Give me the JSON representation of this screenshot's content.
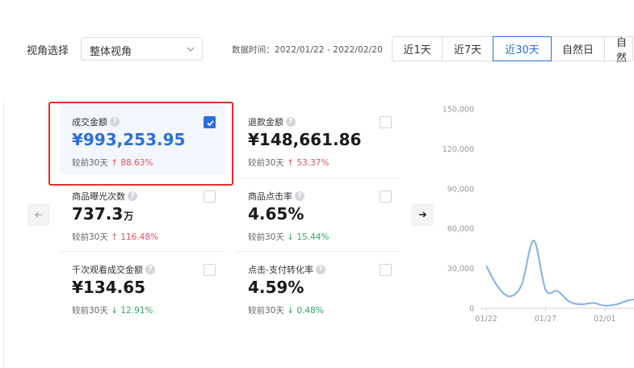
{
  "filter": {
    "label": "视角选择",
    "selected": "整体视角"
  },
  "date_range": "数据时间：2022/01/22 - 2022/02/20",
  "range_tabs": [
    {
      "label": "近1天",
      "active": false
    },
    {
      "label": "近7天",
      "active": false
    },
    {
      "label": "近30天",
      "active": true
    },
    {
      "label": "自然日",
      "active": false
    },
    {
      "label": "自然",
      "active": false
    }
  ],
  "metrics": [
    {
      "title": "成交金额",
      "value": "¥993,253.95",
      "unit": "",
      "compare_label": "较前30天",
      "delta": "88.63%",
      "direction": "up",
      "checked": true
    },
    {
      "title": "退款金额",
      "value": "¥148,661.86",
      "unit": "",
      "compare_label": "较前30天",
      "delta": "53.37%",
      "direction": "up",
      "checked": false
    },
    {
      "title": "商品曝光次数",
      "value": "737.3",
      "unit": "万",
      "compare_label": "较前30天",
      "delta": "116.48%",
      "direction": "up",
      "checked": false
    },
    {
      "title": "商品点击率",
      "value": "4.65%",
      "unit": "",
      "compare_label": "较前30天",
      "delta": "15.44%",
      "direction": "down",
      "checked": false
    },
    {
      "title": "千次观看成交金额",
      "value": "¥134.65",
      "unit": "",
      "compare_label": "较前30天",
      "delta": "12.91%",
      "direction": "down",
      "checked": false
    },
    {
      "title": "点击-支付转化率",
      "value": "4.59%",
      "unit": "",
      "compare_label": "较前30天",
      "delta": "0.48%",
      "direction": "down",
      "checked": false
    }
  ],
  "colors": {
    "accent": "#2a6fe0",
    "up": "#e8505b",
    "down": "#2fab5c",
    "highlight_frame": "#d9332a",
    "line": "#86aee8"
  },
  "chart_data": {
    "type": "line",
    "y_ticks": [
      "150,000",
      "120,000",
      "90,000",
      "60,000",
      "30,000",
      "0"
    ],
    "x_ticks": [
      "01/22",
      "01/27",
      "02/01"
    ],
    "ylim": [
      0,
      150000
    ],
    "x_range": [
      "01/22",
      "02/04"
    ],
    "grid": false,
    "series": [
      {
        "x": [
          "01/22",
          "01/23",
          "01/24",
          "01/25",
          "01/26",
          "01/27",
          "01/28",
          "01/29",
          "01/30",
          "01/31",
          "02/01",
          "02/02",
          "02/03",
          "02/04"
        ],
        "values": [
          32000,
          16000,
          9000,
          18000,
          51000,
          14000,
          13000,
          5000,
          3000,
          4000,
          2000,
          3000,
          6000,
          7000
        ]
      }
    ]
  }
}
